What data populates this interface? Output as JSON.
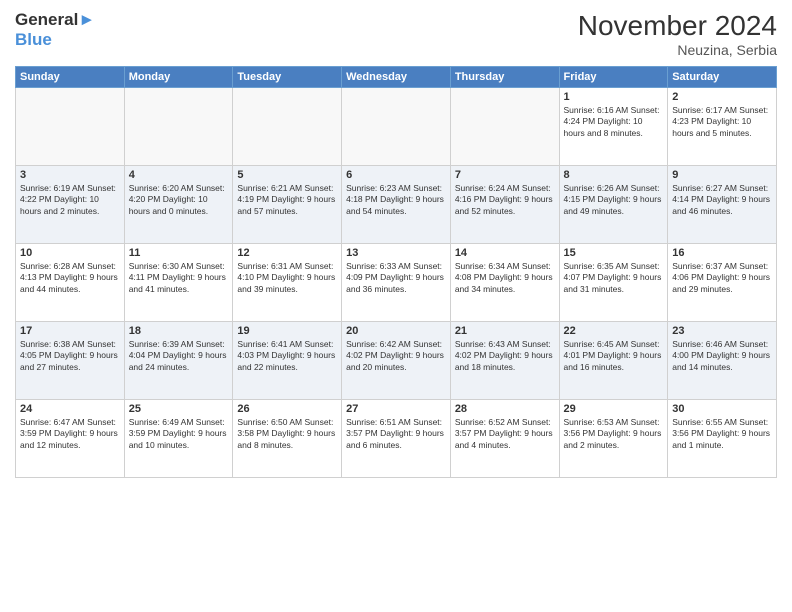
{
  "header": {
    "logo_line1": "General",
    "logo_line2": "Blue",
    "month": "November 2024",
    "location": "Neuzina, Serbia"
  },
  "weekdays": [
    "Sunday",
    "Monday",
    "Tuesday",
    "Wednesday",
    "Thursday",
    "Friday",
    "Saturday"
  ],
  "weeks": [
    [
      {
        "day": "",
        "info": ""
      },
      {
        "day": "",
        "info": ""
      },
      {
        "day": "",
        "info": ""
      },
      {
        "day": "",
        "info": ""
      },
      {
        "day": "",
        "info": ""
      },
      {
        "day": "1",
        "info": "Sunrise: 6:16 AM\nSunset: 4:24 PM\nDaylight: 10 hours and 8 minutes."
      },
      {
        "day": "2",
        "info": "Sunrise: 6:17 AM\nSunset: 4:23 PM\nDaylight: 10 hours and 5 minutes."
      }
    ],
    [
      {
        "day": "3",
        "info": "Sunrise: 6:19 AM\nSunset: 4:22 PM\nDaylight: 10 hours and 2 minutes."
      },
      {
        "day": "4",
        "info": "Sunrise: 6:20 AM\nSunset: 4:20 PM\nDaylight: 10 hours and 0 minutes."
      },
      {
        "day": "5",
        "info": "Sunrise: 6:21 AM\nSunset: 4:19 PM\nDaylight: 9 hours and 57 minutes."
      },
      {
        "day": "6",
        "info": "Sunrise: 6:23 AM\nSunset: 4:18 PM\nDaylight: 9 hours and 54 minutes."
      },
      {
        "day": "7",
        "info": "Sunrise: 6:24 AM\nSunset: 4:16 PM\nDaylight: 9 hours and 52 minutes."
      },
      {
        "day": "8",
        "info": "Sunrise: 6:26 AM\nSunset: 4:15 PM\nDaylight: 9 hours and 49 minutes."
      },
      {
        "day": "9",
        "info": "Sunrise: 6:27 AM\nSunset: 4:14 PM\nDaylight: 9 hours and 46 minutes."
      }
    ],
    [
      {
        "day": "10",
        "info": "Sunrise: 6:28 AM\nSunset: 4:13 PM\nDaylight: 9 hours and 44 minutes."
      },
      {
        "day": "11",
        "info": "Sunrise: 6:30 AM\nSunset: 4:11 PM\nDaylight: 9 hours and 41 minutes."
      },
      {
        "day": "12",
        "info": "Sunrise: 6:31 AM\nSunset: 4:10 PM\nDaylight: 9 hours and 39 minutes."
      },
      {
        "day": "13",
        "info": "Sunrise: 6:33 AM\nSunset: 4:09 PM\nDaylight: 9 hours and 36 minutes."
      },
      {
        "day": "14",
        "info": "Sunrise: 6:34 AM\nSunset: 4:08 PM\nDaylight: 9 hours and 34 minutes."
      },
      {
        "day": "15",
        "info": "Sunrise: 6:35 AM\nSunset: 4:07 PM\nDaylight: 9 hours and 31 minutes."
      },
      {
        "day": "16",
        "info": "Sunrise: 6:37 AM\nSunset: 4:06 PM\nDaylight: 9 hours and 29 minutes."
      }
    ],
    [
      {
        "day": "17",
        "info": "Sunrise: 6:38 AM\nSunset: 4:05 PM\nDaylight: 9 hours and 27 minutes."
      },
      {
        "day": "18",
        "info": "Sunrise: 6:39 AM\nSunset: 4:04 PM\nDaylight: 9 hours and 24 minutes."
      },
      {
        "day": "19",
        "info": "Sunrise: 6:41 AM\nSunset: 4:03 PM\nDaylight: 9 hours and 22 minutes."
      },
      {
        "day": "20",
        "info": "Sunrise: 6:42 AM\nSunset: 4:02 PM\nDaylight: 9 hours and 20 minutes."
      },
      {
        "day": "21",
        "info": "Sunrise: 6:43 AM\nSunset: 4:02 PM\nDaylight: 9 hours and 18 minutes."
      },
      {
        "day": "22",
        "info": "Sunrise: 6:45 AM\nSunset: 4:01 PM\nDaylight: 9 hours and 16 minutes."
      },
      {
        "day": "23",
        "info": "Sunrise: 6:46 AM\nSunset: 4:00 PM\nDaylight: 9 hours and 14 minutes."
      }
    ],
    [
      {
        "day": "24",
        "info": "Sunrise: 6:47 AM\nSunset: 3:59 PM\nDaylight: 9 hours and 12 minutes."
      },
      {
        "day": "25",
        "info": "Sunrise: 6:49 AM\nSunset: 3:59 PM\nDaylight: 9 hours and 10 minutes."
      },
      {
        "day": "26",
        "info": "Sunrise: 6:50 AM\nSunset: 3:58 PM\nDaylight: 9 hours and 8 minutes."
      },
      {
        "day": "27",
        "info": "Sunrise: 6:51 AM\nSunset: 3:57 PM\nDaylight: 9 hours and 6 minutes."
      },
      {
        "day": "28",
        "info": "Sunrise: 6:52 AM\nSunset: 3:57 PM\nDaylight: 9 hours and 4 minutes."
      },
      {
        "day": "29",
        "info": "Sunrise: 6:53 AM\nSunset: 3:56 PM\nDaylight: 9 hours and 2 minutes."
      },
      {
        "day": "30",
        "info": "Sunrise: 6:55 AM\nSunset: 3:56 PM\nDaylight: 9 hours and 1 minute."
      }
    ]
  ]
}
